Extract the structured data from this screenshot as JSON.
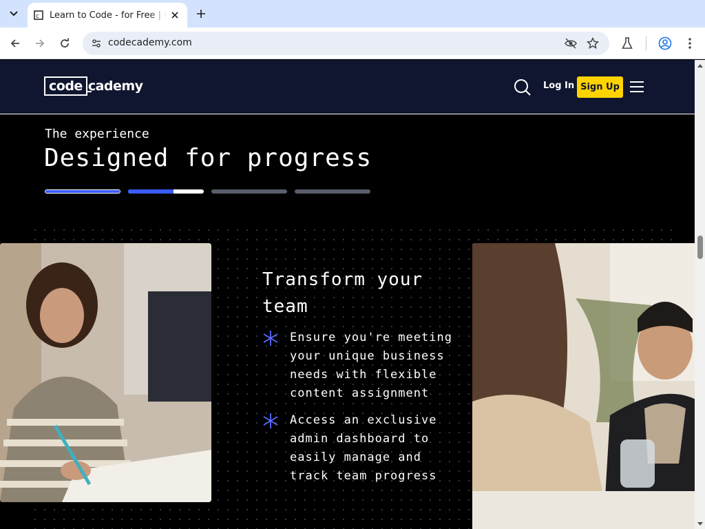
{
  "browser": {
    "tab_title": "Learn to Code - for Free | Codecademy",
    "url": "codecademy.com"
  },
  "header": {
    "logo_code": "code",
    "logo_cademy": "cademy",
    "login_label": "Log In",
    "signup_label": "Sign Up"
  },
  "section": {
    "eyebrow": "The experience",
    "headline": "Designed for progress",
    "progress": [
      1.0,
      0.6,
      0.0,
      0.0
    ]
  },
  "feature": {
    "title": "Transform your team",
    "bullets": [
      "Ensure you're meeting your unique business needs with flexible content assignment",
      "Access an exclusive admin dashboard to easily manage and track team progress"
    ]
  },
  "colors": {
    "header_bg": "#10162f",
    "signup_bg": "#ffd300",
    "accent": "#3a5cff"
  }
}
